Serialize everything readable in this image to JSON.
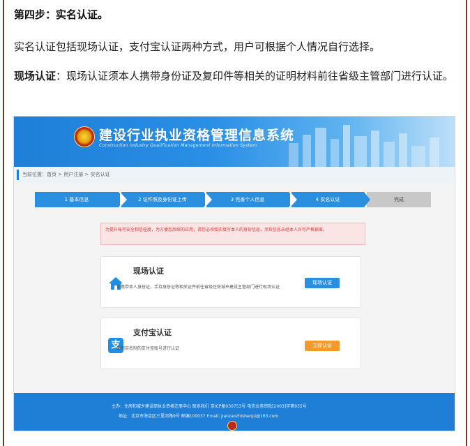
{
  "article": {
    "heading": "第四步：实名认证。",
    "intro": "实名认证包括现场认证，支付宝认证两种方式，用户可根据个人情况自行选择。",
    "onsite_label": "现场认证",
    "onsite_text": "：现场认证须本人携带身份证及复印件等相关的证明材料前往省级主管部门进行认证。"
  },
  "screenshot": {
    "system_title": "建设行业执业资格管理信息系统",
    "system_subtitle": "Construction Industry Qualification Management Information System",
    "breadcrumb": "当前位置：首页 > 用户注册 > 实名认证",
    "steps": [
      "1 基本信息",
      "2 证件照及身份证上传",
      "3 完善个人信息",
      "4 实名认证",
      "完成"
    ],
    "notice": "为提升账号安全和信任度，为方便您后续的应用，请您必须如实填写本人的身份信息，涉及信息未经本人许可严格保密。",
    "onsite_card": {
      "title": "现场认证",
      "desc": "请携带本人身份证，手持身份证等相关证件前往省级住房城乡建设主管部门进行现场认证",
      "button": "现场认证",
      "icon": "home-icon"
    },
    "alipay_card": {
      "title": "支付宝认证",
      "desc": "使用实名制的支付宝账号进行认证",
      "button": "立即认证",
      "icon": "alipay-icon"
    },
    "footer_line1": "主办：住房和城乡建设部执业资格注册中心  联系我们  京ICP备030753号  电信业务审批[2003]字第935号",
    "footer_line2": "地址：北京市海淀区三里河路9号 邮编100037  Email: jianzaozhishenpi@163.com"
  },
  "colors": {
    "header_blue": "#1e7fd8",
    "step_blue": "#2b8fe0",
    "notice_red": "#d43a3a",
    "button_orange": "#f39a2b",
    "border_brown": "#6b3a2a"
  }
}
